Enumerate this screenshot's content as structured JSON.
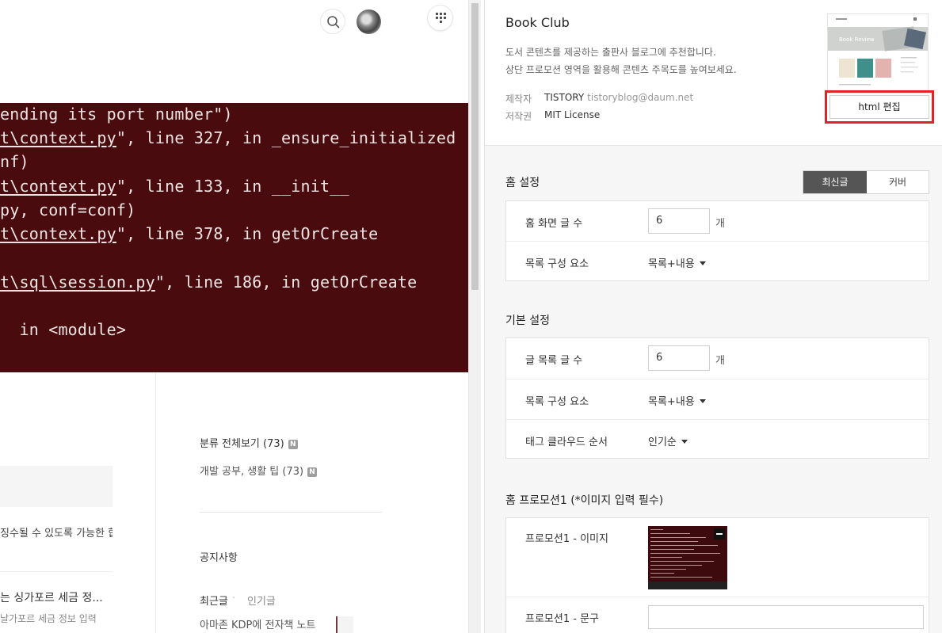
{
  "preview": {
    "code_lines": [
      {
        "pre": "",
        "u": "",
        "post": "ending its port number\")"
      },
      {
        "pre": "",
        "u": "t\\context.py",
        "post": "\", line 327, in _ensure_initialized"
      },
      {
        "pre": "",
        "u": "",
        "post": "nf)"
      },
      {
        "pre": "",
        "u": "t\\context.py",
        "post": "\", line 133, in __init__"
      },
      {
        "pre": "",
        "u": "",
        "post": "py, conf=conf)"
      },
      {
        "pre": "",
        "u": "t\\context.py",
        "post": "\", line 378, in getOrCreate"
      },
      {
        "pre": "",
        "u": "t\\sql\\session.py",
        "post": "\", line 186, in getOrCreate"
      },
      {
        "pre": "",
        "u": "",
        "post": "  in <module>"
      }
    ],
    "left_texts": {
      "excerpt": "징수될 수 있도록 가능한 합",
      "post_title": "는 싱가포르 세금 정...",
      "post_sub": "날가포르 세금 정보 입력"
    },
    "sidebar": {
      "category_all": "분류 전체보기 (73)",
      "category_item": "개발 공부, 생활 팁 (73)",
      "badge": "N",
      "notice": "공지사항",
      "tab_recent": "최근글",
      "tab_popular": "인기글",
      "recent_post": "아마존 KDP에 전자책 노트"
    }
  },
  "skin": {
    "name": "Book Club",
    "desc1": "도서 콘텐츠를 제공하는 출판사 블로그에 추천합니다.",
    "desc2": "상단 프로모션 영역을 활용해 콘텐츠 주목도를 높여보세요.",
    "maker_label": "제작자",
    "maker": "TISTORY",
    "maker_email": "tistoryblog@daum.net",
    "license_label": "저작권",
    "license": "MIT License",
    "thumb_banner": "Book Review",
    "html_edit": "html 편집"
  },
  "home": {
    "title": "홈 설정",
    "seg_recent": "최신글",
    "seg_cover": "커버",
    "count_label": "홈 화면 글 수",
    "count_value": "6",
    "unit": "개",
    "list_label": "목록 구성 요소",
    "list_value": "목록+내용"
  },
  "basic": {
    "title": "기본 설정",
    "count_label": "글 목록 글 수",
    "count_value": "6",
    "unit": "개",
    "list_label": "목록 구성 요소",
    "list_value": "목록+내용",
    "tag_label": "태그 클라우드 순서",
    "tag_value": "인기순"
  },
  "promo": {
    "title": "홈 프로모션1 (*이미지 입력 필수)",
    "image_label": "프로모션1 - 이미지",
    "text_label": "프로모션1 - 문구"
  }
}
